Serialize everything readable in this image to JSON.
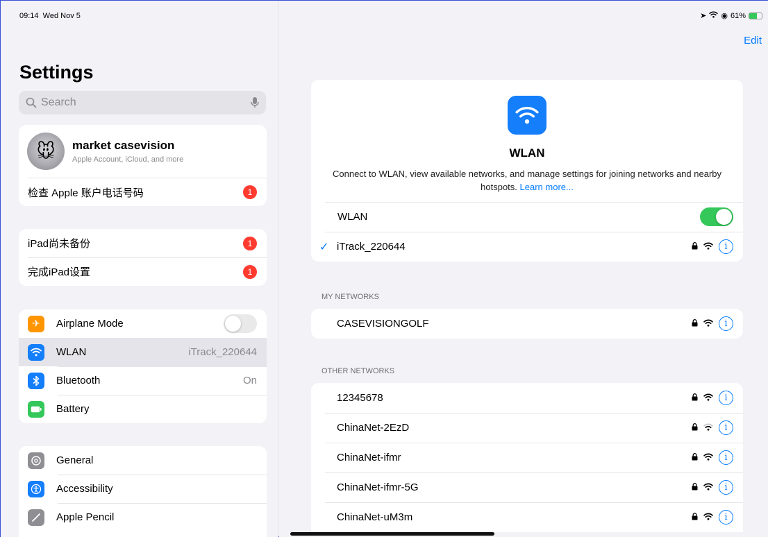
{
  "status": {
    "time": "09:14",
    "date": "Wed Nov 5",
    "battery": "61%"
  },
  "colors": {
    "accent": "#007aff",
    "toggle_on": "#34c759",
    "badge": "#ff3b30",
    "airplane": "#ff9500",
    "wlan": "#147efb",
    "bluetooth": "#147efb",
    "battery": "#34c759",
    "general": "#8e8e93",
    "accessibility": "#147efb",
    "pencil": "#8e8e93"
  },
  "sidebar": {
    "title": "Settings",
    "search_placeholder": "Search",
    "account": {
      "name": "market casevision",
      "subtitle": "Apple Account, iCloud, and more"
    },
    "account_alert": {
      "label": "检查 Apple 账户电话号码",
      "badge": "1"
    },
    "alerts": [
      {
        "label": "iPad尚未备份",
        "badge": "1"
      },
      {
        "label": "完成iPad设置",
        "badge": "1"
      }
    ],
    "connectivity": [
      {
        "label": "Airplane Mode",
        "icon": "airplane-icon"
      },
      {
        "label": "WLAN",
        "value": "iTrack_220644",
        "icon": "wifi-icon"
      },
      {
        "label": "Bluetooth",
        "value": "On",
        "icon": "bluetooth-icon"
      },
      {
        "label": "Battery",
        "icon": "battery-icon"
      }
    ],
    "general": [
      {
        "label": "General",
        "icon": "gear-icon"
      },
      {
        "label": "Accessibility",
        "icon": "accessibility-icon"
      },
      {
        "label": "Apple Pencil",
        "icon": "pencil-icon"
      }
    ]
  },
  "detail": {
    "edit_label": "Edit",
    "hero_title": "WLAN",
    "hero_desc": "Connect to WLAN, view available networks, and manage settings for joining networks and nearby hotspots.",
    "learn_more": "Learn more...",
    "wlan_toggle_label": "WLAN",
    "connected_network": "iTrack_220644",
    "my_networks_header": "MY NETWORKS",
    "my_networks": [
      "CASEVISIONGOLF"
    ],
    "other_networks_header": "OTHER NETWORKS",
    "other_networks": [
      "12345678",
      "ChinaNet-2EzD",
      "ChinaNet-ifmr",
      "ChinaNet-ifmr-5G",
      "ChinaNet-uM3m"
    ]
  }
}
